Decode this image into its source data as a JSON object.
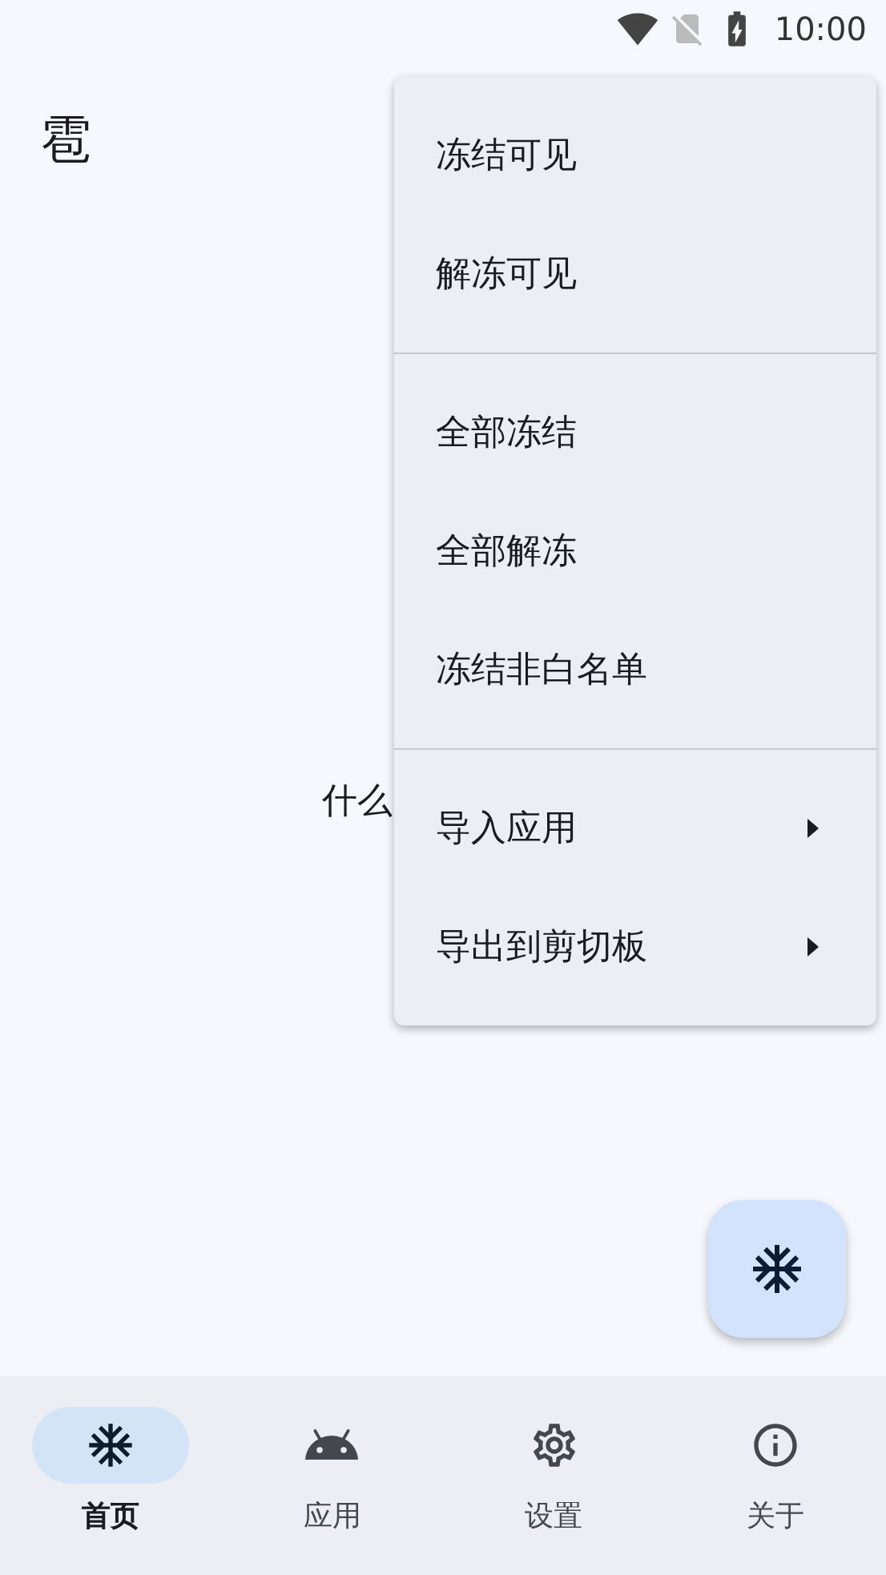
{
  "status_bar": {
    "time": "10:00"
  },
  "app_bar": {
    "title": "雹"
  },
  "body": {
    "text": "什么"
  },
  "menu": {
    "groups": [
      {
        "items": [
          {
            "label": "冻结可见",
            "has_submenu": false
          },
          {
            "label": "解冻可见",
            "has_submenu": false
          }
        ]
      },
      {
        "items": [
          {
            "label": "全部冻结",
            "has_submenu": false
          },
          {
            "label": "全部解冻",
            "has_submenu": false
          },
          {
            "label": "冻结非白名单",
            "has_submenu": false
          }
        ]
      },
      {
        "items": [
          {
            "label": "导入应用",
            "has_submenu": true
          },
          {
            "label": "导出到剪切板",
            "has_submenu": true
          }
        ]
      }
    ]
  },
  "bottom_nav": {
    "items": [
      {
        "label": "首页",
        "kind": "home",
        "selected": true
      },
      {
        "label": "应用",
        "kind": "apps",
        "selected": false
      },
      {
        "label": "设置",
        "kind": "settings",
        "selected": false
      },
      {
        "label": "关于",
        "kind": "about",
        "selected": false
      }
    ]
  }
}
